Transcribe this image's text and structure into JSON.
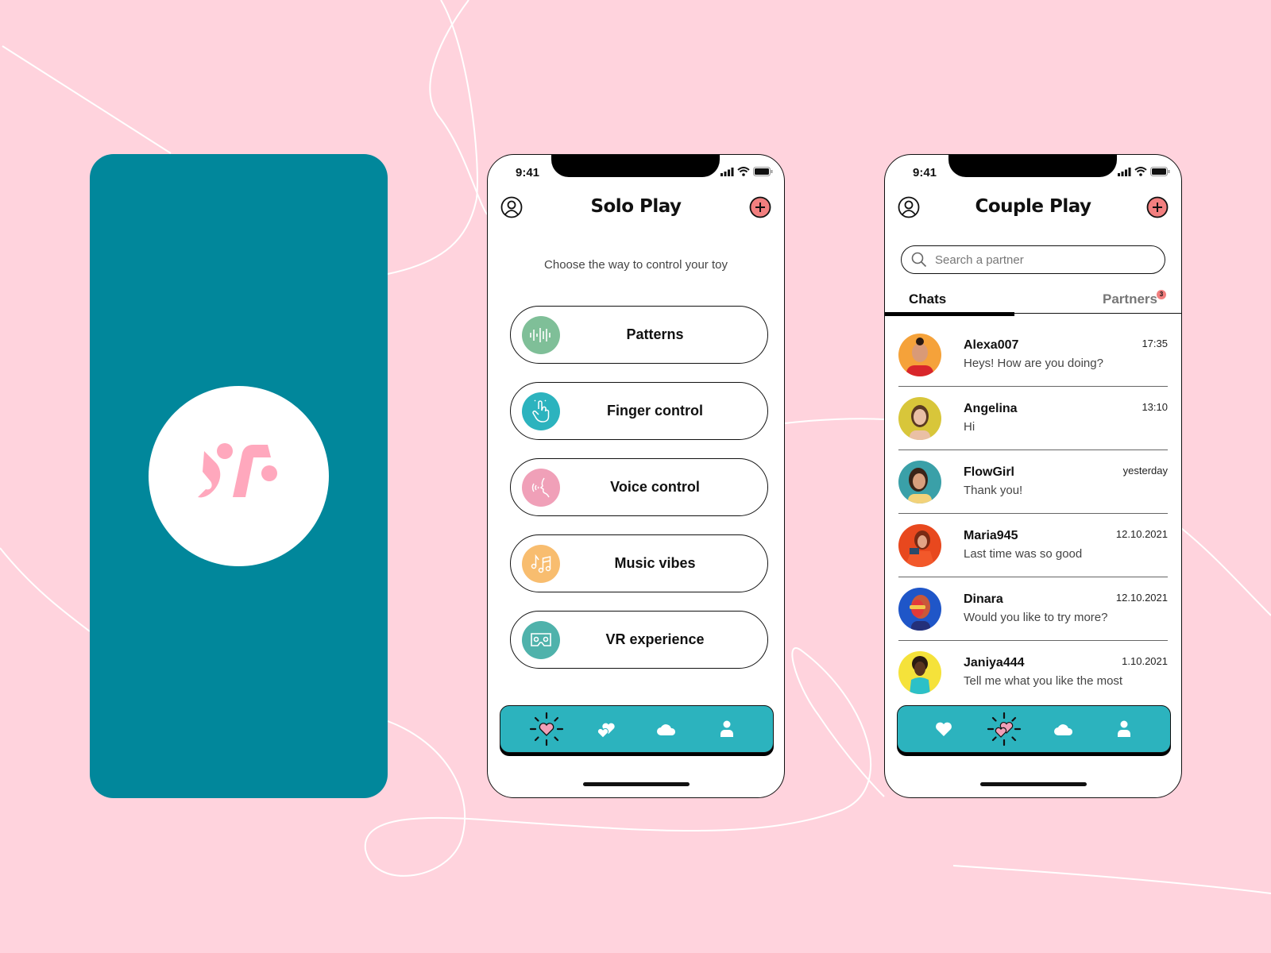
{
  "colors": {
    "background": "#ffd3dd",
    "splash": "#01879b",
    "logo": "#ffa8bd",
    "tabbar": "#2cb3be",
    "accent_add": "#f27f7f"
  },
  "status_bar": {
    "time": "9:41"
  },
  "solo": {
    "title": "Solo Play",
    "subtitle": "Choose the way to control your toy",
    "options": [
      {
        "label": "Patterns",
        "icon": "sound-wave-icon",
        "color": "#7fbf98"
      },
      {
        "label": "Finger control",
        "icon": "tap-hand-icon",
        "color": "#2cb3be"
      },
      {
        "label": "Voice control",
        "icon": "voice-icon",
        "color": "#f0a0b8"
      },
      {
        "label": "Music vibes",
        "icon": "music-notes-icon",
        "color": "#f8bd6f"
      },
      {
        "label": "VR experience",
        "icon": "vr-headset-icon",
        "color": "#4fb2ab"
      }
    ],
    "tabbar": [
      "solo-heart-icon",
      "couple-hearts-icon",
      "cloud-icon",
      "profile-icon"
    ],
    "active_tab": 0
  },
  "couple": {
    "title": "Couple Play",
    "search_placeholder": "Search a partner",
    "tabs": {
      "chats": "Chats",
      "partners": "Partners",
      "partners_badge": "3"
    },
    "chats": [
      {
        "name": "Alexa007",
        "message": "Heys! How are you doing?",
        "time": "17:35",
        "avatar_bg": "#f5a23a"
      },
      {
        "name": "Angelina",
        "message": "Hi",
        "time": "13:10",
        "avatar_bg": "#d8c63a"
      },
      {
        "name": "FlowGirl",
        "message": "Thank you!",
        "time": "yesterday",
        "avatar_bg": "#3aa0a8"
      },
      {
        "name": "Maria945",
        "message": "Last time was so good",
        "time": "12.10.2021",
        "avatar_bg": "#e8481e"
      },
      {
        "name": "Dinara",
        "message": "Would you like to try more?",
        "time": "12.10.2021",
        "avatar_bg": "#1f56c8"
      },
      {
        "name": "Janiya444",
        "message": "Tell me what you like the most",
        "time": "1.10.2021",
        "avatar_bg": "#f5e23a"
      }
    ],
    "active_tab": 1
  }
}
